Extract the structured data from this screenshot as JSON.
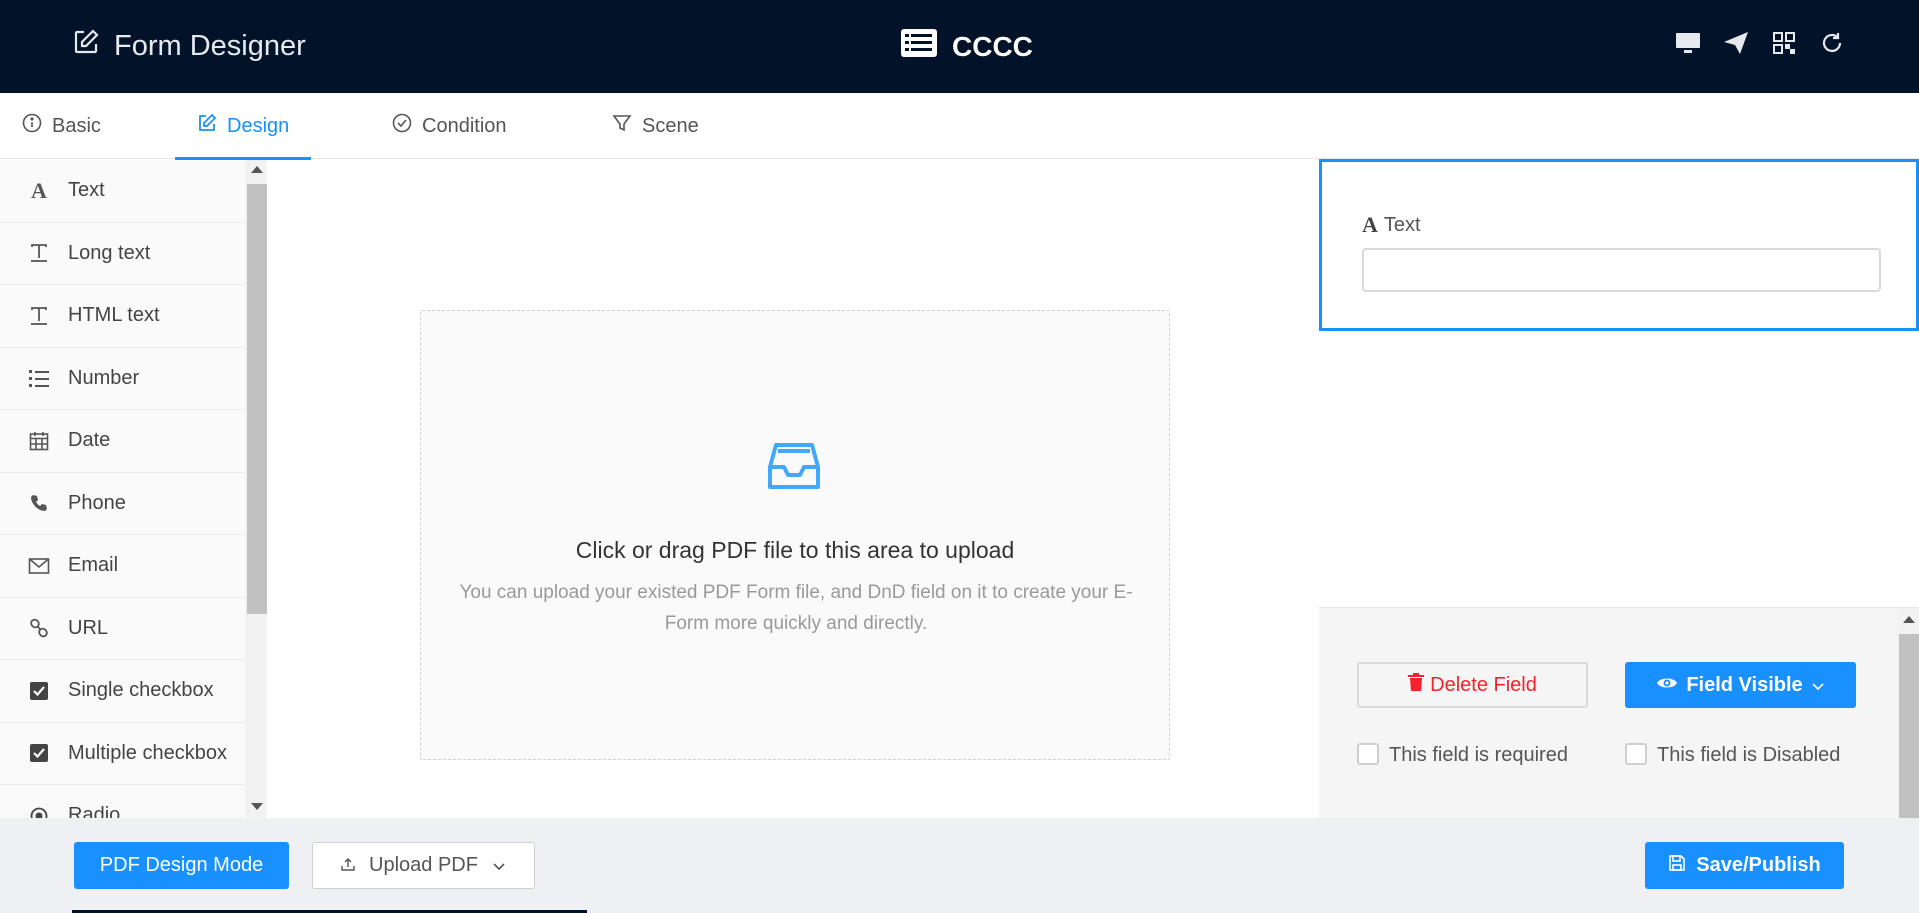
{
  "header": {
    "app_title": "Form Designer",
    "form_name": "CCCC",
    "icons": [
      "desktop-icon",
      "send-icon",
      "qrcode-icon",
      "reload-icon"
    ]
  },
  "tabs": [
    {
      "label": "Basic",
      "icon": "info-icon"
    },
    {
      "label": "Design",
      "icon": "edit-icon",
      "active": true
    },
    {
      "label": "Condition",
      "icon": "check-circle-icon"
    },
    {
      "label": "Scene",
      "icon": "filter-icon"
    }
  ],
  "sidebar": {
    "items": [
      {
        "label": "Text",
        "icon": "font-icon"
      },
      {
        "label": "Long text",
        "icon": "text-icon"
      },
      {
        "label": "HTML text",
        "icon": "text-icon"
      },
      {
        "label": "Number",
        "icon": "ordered-list-icon"
      },
      {
        "label": "Date",
        "icon": "calendar-icon"
      },
      {
        "label": "Phone",
        "icon": "phone-icon"
      },
      {
        "label": "Email",
        "icon": "mail-icon"
      },
      {
        "label": "URL",
        "icon": "link-icon"
      },
      {
        "label": "Single checkbox",
        "icon": "checkbox-icon"
      },
      {
        "label": "Multiple checkbox",
        "icon": "checkbox-icon"
      },
      {
        "label": "Radio",
        "icon": "radio-icon"
      }
    ]
  },
  "dropzone": {
    "title": "Click or drag PDF file to this area to upload",
    "hint": "You can upload your existed PDF Form file, and DnD field on it to create your E-Form more quickly and directly."
  },
  "field_preview": {
    "label": "Text"
  },
  "field_panel": {
    "delete_label": "Delete Field",
    "visible_label": "Field Visible",
    "required_label": "This field is required",
    "disabled_label": "This field is Disabled"
  },
  "footer": {
    "pdf_mode_label": "PDF Design Mode",
    "upload_label": "Upload PDF",
    "save_label": "Save/Publish"
  },
  "colors": {
    "header_bg": "#021229",
    "accent": "#1890ff",
    "danger": "#f5222d"
  }
}
